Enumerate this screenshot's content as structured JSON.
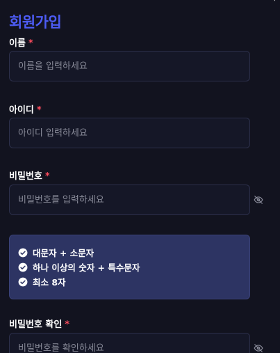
{
  "page": {
    "title": "회원가입",
    "corner_mark": "’"
  },
  "fields": [
    {
      "label": "이름",
      "required_mark": "*",
      "placeholder": "이름을 입력하세요",
      "value": ""
    },
    {
      "label": "아이디",
      "required_mark": "*",
      "placeholder": "아이디 입력하세요",
      "value": ""
    },
    {
      "label": "비밀번호",
      "required_mark": "*",
      "placeholder": "비밀번호를 입력하세요",
      "value": "",
      "toggle_icon": "eye-off-icon"
    },
    {
      "label": "비밀번호 확인",
      "required_mark": "*",
      "placeholder": "비밀번호를 확인하세요",
      "value": "",
      "toggle_icon": "eye-off-icon"
    }
  ],
  "password_rules": {
    "icon": "check-circle-icon",
    "items": [
      "대문자 + 소문자",
      "하나 이상의 숫자 + 특수문자",
      "최소 8자"
    ]
  },
  "colors": {
    "background": "#12131f",
    "title": "#4d5cf5",
    "required": "#ff4d5e",
    "input_background": "#151727",
    "input_border": "#2c2f4a",
    "placeholder": "#8a8c9a",
    "rules_background": "#2d3463"
  }
}
